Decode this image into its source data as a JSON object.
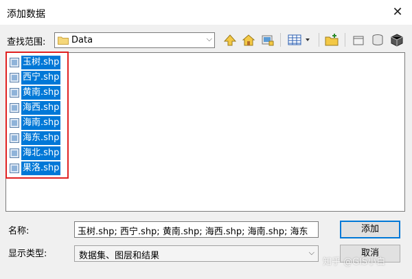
{
  "window": {
    "title": "添加数据"
  },
  "toolbar": {
    "look_in_label": "查找范围:",
    "look_in_value": "Data",
    "icons": [
      "up-one-level-icon",
      "home-icon",
      "connect-folder-icon",
      "view-menu-icon",
      "new-folder-icon",
      "new-item-icon",
      "new-database-icon",
      "new-geodatabase-icon"
    ]
  },
  "files": [
    {
      "name": "玉树.shp"
    },
    {
      "name": "西宁.shp"
    },
    {
      "name": "黄南.shp"
    },
    {
      "name": "海西.shp"
    },
    {
      "name": "海南.shp"
    },
    {
      "name": "海东.shp"
    },
    {
      "name": "海北.shp"
    },
    {
      "name": "果洛.shp"
    }
  ],
  "name_field": {
    "label": "名称:",
    "value": "玉树.shp; 西宁.shp; 黄南.shp; 海西.shp; 海南.shp; 海东"
  },
  "type_field": {
    "label": "显示类型:",
    "value": "数据集、图层和结果"
  },
  "buttons": {
    "add": "添加",
    "cancel": "取消"
  },
  "watermark": "知乎 @GIS小白",
  "colors": {
    "selection": "#0078d7",
    "highlight_box": "#e02020"
  }
}
